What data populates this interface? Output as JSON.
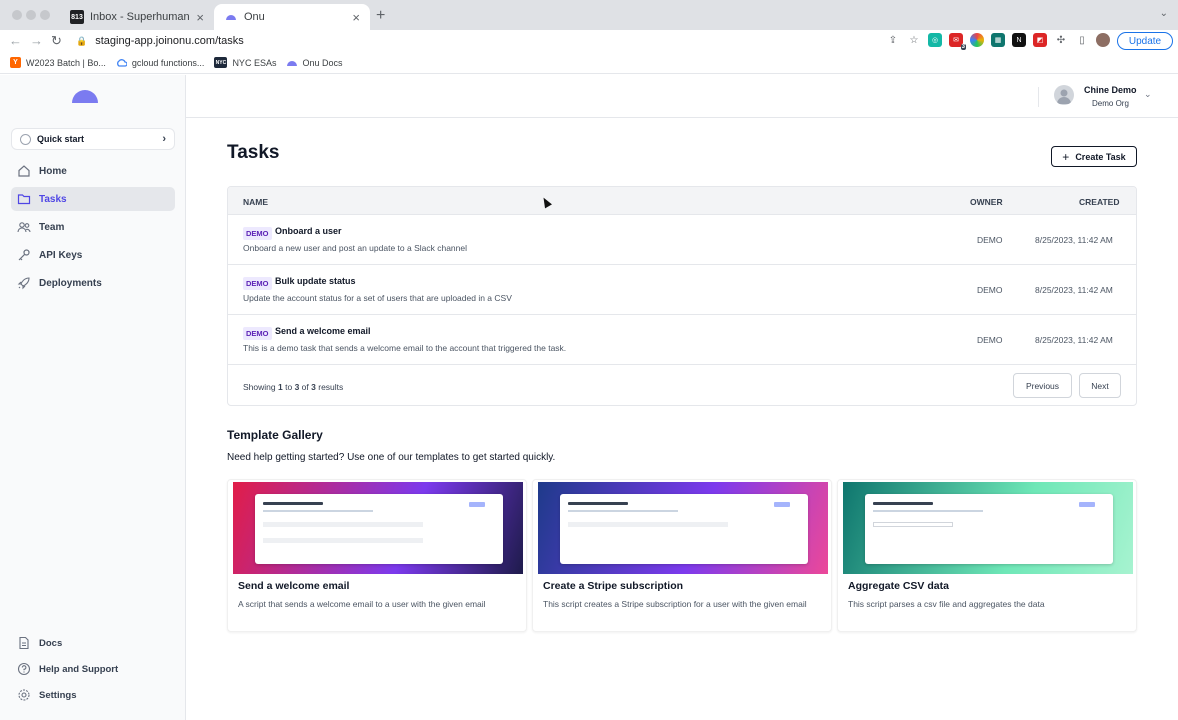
{
  "browser": {
    "tabs": [
      {
        "label": "Inbox - Superhuman",
        "favicon_text": "813",
        "favicon_color": "#202124"
      },
      {
        "label": "Onu",
        "favicon_color": "#7b7bf0"
      }
    ],
    "url": "staging-app.joinonu.com/tasks",
    "update_label": "Update",
    "extension_badge": "3",
    "bookmarks": [
      {
        "label": "W2023 Batch | Bo...",
        "icon_text": "Y",
        "icon_color": "#ff6600"
      },
      {
        "label": "gcloud functions...",
        "icon": "gcloud-icon"
      },
      {
        "label": "NYC ESAs",
        "icon_text": "NYC",
        "icon_color": "#1e293b"
      },
      {
        "label": "Onu Docs",
        "icon_color": "#7b7bf0"
      }
    ]
  },
  "sidebar": {
    "quick_start": "Quick start",
    "items": [
      {
        "label": "Home",
        "icon": "home-icon"
      },
      {
        "label": "Tasks",
        "icon": "folder-icon",
        "active": true
      },
      {
        "label": "Team",
        "icon": "team-icon"
      },
      {
        "label": "API Keys",
        "icon": "key-icon"
      },
      {
        "label": "Deployments",
        "icon": "rocket-icon"
      }
    ],
    "bottom": [
      {
        "label": "Docs",
        "icon": "doc-icon"
      },
      {
        "label": "Help and Support",
        "icon": "help-icon"
      },
      {
        "label": "Settings",
        "icon": "gear-icon"
      }
    ]
  },
  "user": {
    "name": "Chine Demo",
    "org": "Demo Org"
  },
  "page": {
    "title": "Tasks",
    "create_label": "Create Task"
  },
  "table": {
    "headers": {
      "name": "NAME",
      "owner": "OWNER",
      "created": "CREATED"
    },
    "rows": [
      {
        "badge": "DEMO",
        "name": "Onboard a user",
        "description": "Onboard a new user and post an update to a Slack channel",
        "owner": "DEMO",
        "created": "8/25/2023, 11:42 AM"
      },
      {
        "badge": "DEMO",
        "name": "Bulk update status",
        "description": "Update the account status for a set of users that are uploaded in a CSV",
        "owner": "DEMO",
        "created": "8/25/2023, 11:42 AM"
      },
      {
        "badge": "DEMO",
        "name": "Send a welcome email",
        "description": "This is a demo task that sends a welcome email to the account that triggered the task.",
        "owner": "DEMO",
        "created": "8/25/2023, 11:42 AM"
      }
    ],
    "showing": {
      "prefix": "Showing",
      "from": "1",
      "to_word": "to",
      "to": "3",
      "of_word": "of",
      "total": "3",
      "suffix": "results"
    },
    "previous_label": "Previous",
    "next_label": "Next"
  },
  "gallery": {
    "title": "Template Gallery",
    "subtitle": "Need help getting started? Use one of our templates to get started quickly.",
    "cards": [
      {
        "title": "Send a welcome email",
        "description": "A script that sends a welcome email to a user with the given email",
        "gradient": [
          "#e11d48",
          "#7c3aed",
          "#1e1b4b"
        ]
      },
      {
        "title": "Create a Stripe subscription",
        "description": "This script creates a Stripe subscription for a user with the given email",
        "gradient": [
          "#1e3a8a",
          "#7c3aed",
          "#ec4899"
        ]
      },
      {
        "title": "Aggregate CSV data",
        "description": "This script parses a csv file and aggregates the data",
        "gradient": [
          "#0f766e",
          "#6ee7b7",
          "#a7f3d0"
        ]
      }
    ]
  }
}
